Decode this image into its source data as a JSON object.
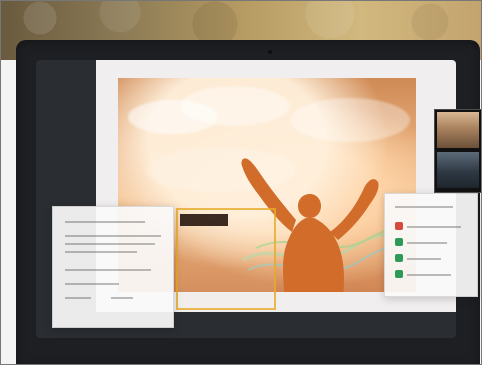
{
  "scene": {
    "description": "",
    "colors": {
      "wall": "#b59a62",
      "laptop": "#1d1f22",
      "sky_warm": "#e9b07e",
      "silhouette": "#d26c2a",
      "sticky_border": "#e6aa28",
      "panel": "#fafafa",
      "accent_red": "#d24b3c",
      "accent_green": "#2d9b57"
    }
  },
  "icons": {
    "camera": "camera-icon"
  }
}
